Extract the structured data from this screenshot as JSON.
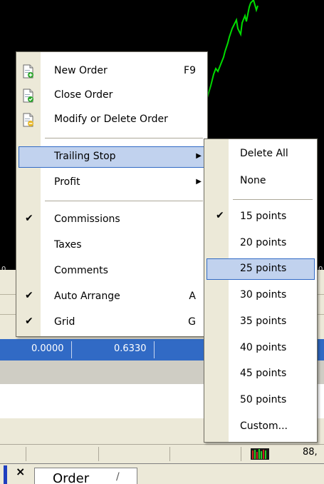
{
  "chart": {
    "edge_label_left": "0.",
    "edge_label_right": "0"
  },
  "main_menu": {
    "items": [
      {
        "label": "New Order",
        "shortcut": "F9",
        "icon": "new-order-icon"
      },
      {
        "label": "Close Order",
        "icon": "close-order-icon"
      },
      {
        "label": "Modify or Delete Order",
        "icon": "modify-order-icon"
      },
      {
        "label": "Trailing Stop",
        "submenu": true,
        "highlighted": true
      },
      {
        "label": "Profit",
        "submenu": true
      },
      {
        "label": "Commissions",
        "checked": true
      },
      {
        "label": "Taxes"
      },
      {
        "label": "Comments"
      },
      {
        "label": "Auto Arrange",
        "shortcut": "A",
        "checked": true
      },
      {
        "label": "Grid",
        "shortcut": "G",
        "checked": true
      }
    ]
  },
  "sub_menu": {
    "items": [
      {
        "label": "Delete All"
      },
      {
        "label": "None"
      },
      {
        "label": "15 points",
        "checked": true
      },
      {
        "label": "20 points"
      },
      {
        "label": "25 points",
        "highlighted": true
      },
      {
        "label": "30 points"
      },
      {
        "label": "35 points"
      },
      {
        "label": "40 points"
      },
      {
        "label": "45 points"
      },
      {
        "label": "50 points"
      },
      {
        "label": "Custom..."
      }
    ]
  },
  "selected_row": {
    "cell1": "0.0000",
    "cell2": "0.6330"
  },
  "status_bar": {
    "connection_value": "88,"
  },
  "tabs": {
    "close_glyph": "×",
    "order_label": "Order",
    "separator": "/"
  },
  "icons": {
    "check": "✔",
    "submenu_arrow": "▶"
  },
  "colors": {
    "chart_line": "#00dd00",
    "selection_blue": "#316ac5",
    "menu_highlight": "#c1d2ee",
    "menu_gutter": "#ece9d8"
  }
}
